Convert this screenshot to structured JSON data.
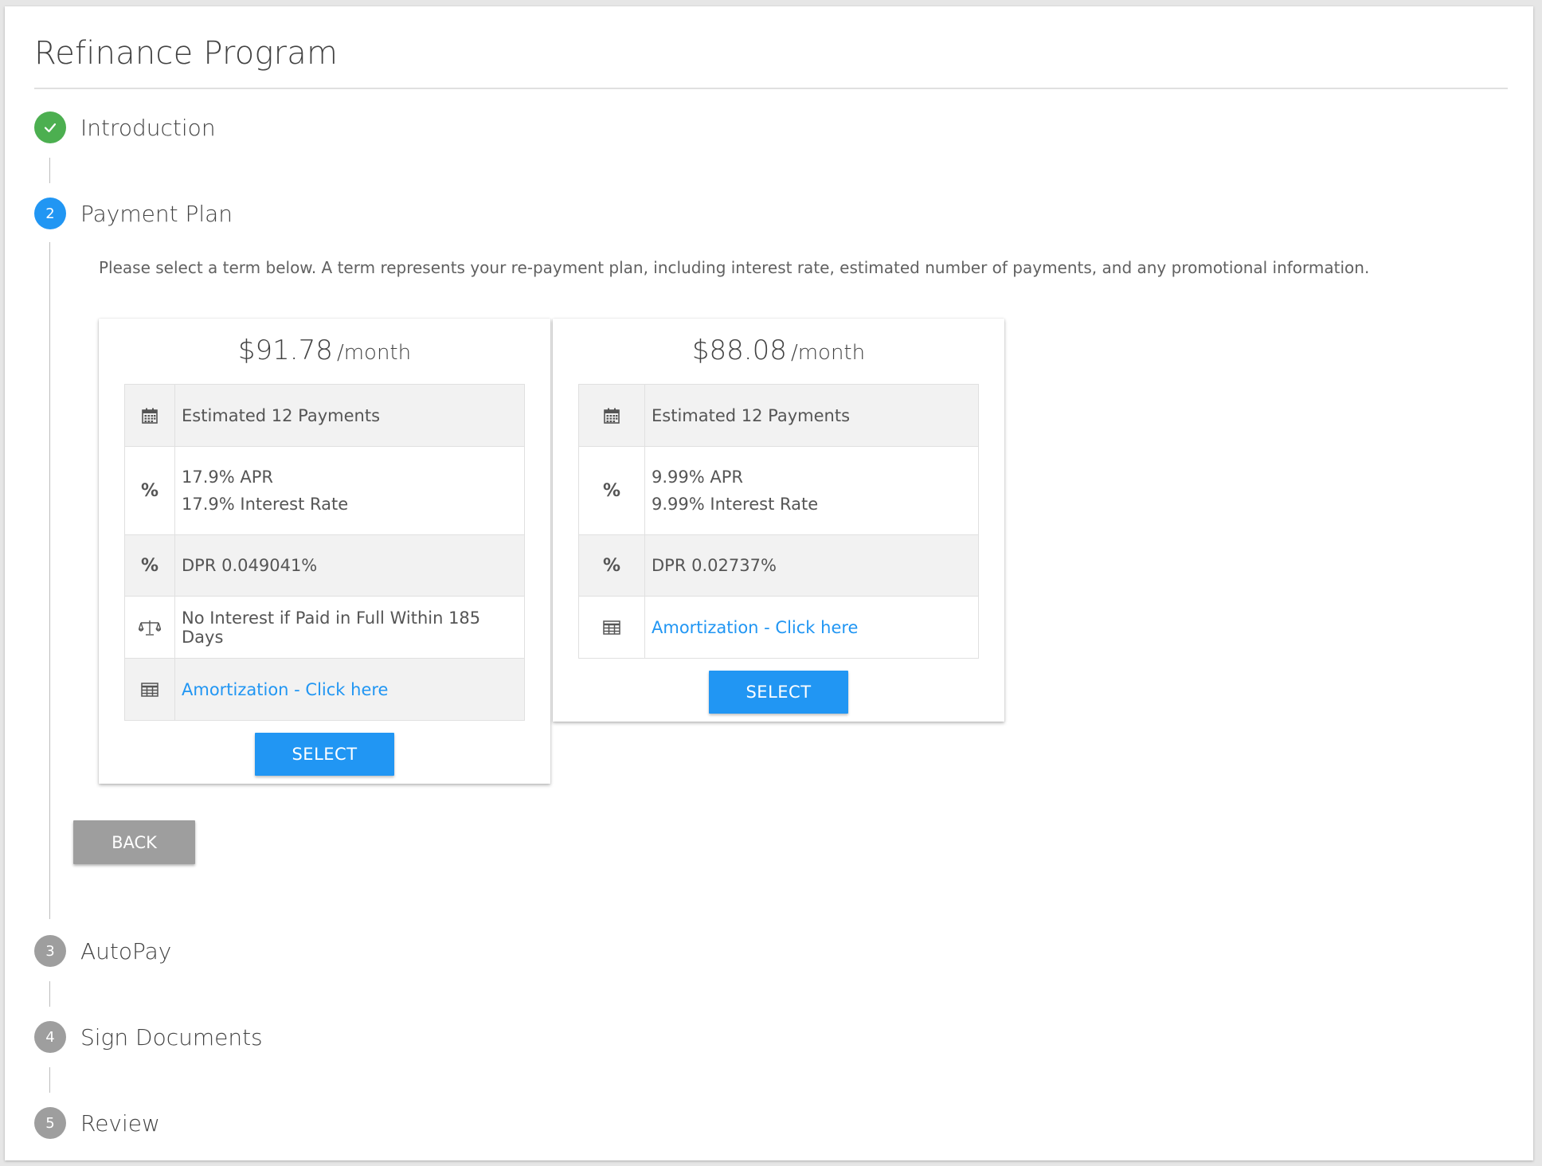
{
  "page": {
    "title": "Refinance Program"
  },
  "steps": [
    {
      "number": "✓",
      "label": "Introduction",
      "state": "done"
    },
    {
      "number": "2",
      "label": "Payment Plan",
      "state": "active"
    },
    {
      "number": "3",
      "label": "AutoPay",
      "state": "todo"
    },
    {
      "number": "4",
      "label": "Sign Documents",
      "state": "todo"
    },
    {
      "number": "5",
      "label": "Review",
      "state": "todo"
    }
  ],
  "payment_plan": {
    "instructions": "Please select a term below. A term represents your re-payment plan, including interest rate, estimated number of payments, and any promotional information.",
    "cards": [
      {
        "price": "$91.78",
        "unit": "/month",
        "payments": "Estimated 12 Payments",
        "apr": "17.9% APR",
        "interest_rate": "17.9% Interest Rate",
        "dpr": "DPR 0.049041%",
        "promo": "No Interest if Paid in Full Within 185 Days",
        "amortization_link": "Amortization - Click here",
        "select_label": "SELECT"
      },
      {
        "price": "$88.08",
        "unit": "/month",
        "payments": "Estimated 12 Payments",
        "apr": "9.99% APR",
        "interest_rate": "9.99% Interest Rate",
        "dpr": "DPR 0.02737%",
        "amortization_link": "Amortization - Click here",
        "select_label": "SELECT"
      }
    ],
    "percent_glyph": "%",
    "back_label": "BACK"
  },
  "icons": {
    "calendar": "calendar-icon",
    "percent": "percent-icon",
    "scale": "balance-scale-icon",
    "table": "table-icon",
    "check": "check-icon"
  },
  "colors": {
    "primary": "#2196f3",
    "success": "#4caf50",
    "inactive": "#9e9e9e"
  }
}
